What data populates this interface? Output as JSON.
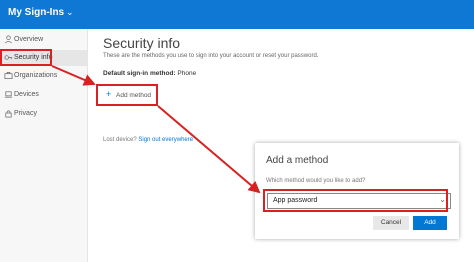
{
  "header": {
    "title": "My Sign-Ins",
    "chevron_icon": "chevron-down-icon"
  },
  "sidebar": {
    "items": [
      {
        "label": "Overview",
        "icon": "person-icon"
      },
      {
        "label": "Security info",
        "icon": "key-icon"
      },
      {
        "label": "Organizations",
        "icon": "briefcase-icon"
      },
      {
        "label": "Devices",
        "icon": "laptop-icon"
      },
      {
        "label": "Privacy",
        "icon": "lock-icon"
      }
    ]
  },
  "main": {
    "title": "Security info",
    "description": "These are the methods you use to sign into your account or reset your password.",
    "default_method_label": "Default sign-in method:",
    "default_method_value": "Phone",
    "add_method_label": "Add method",
    "lost_device_text": "Lost device?",
    "sign_out_link": "Sign out everywhere"
  },
  "dialog": {
    "title": "Add a method",
    "question": "Which method would you like to add?",
    "selected_option": "App password",
    "cancel_label": "Cancel",
    "add_label": "Add"
  },
  "colors": {
    "accent": "#0f78d4",
    "highlight": "#d62222"
  }
}
